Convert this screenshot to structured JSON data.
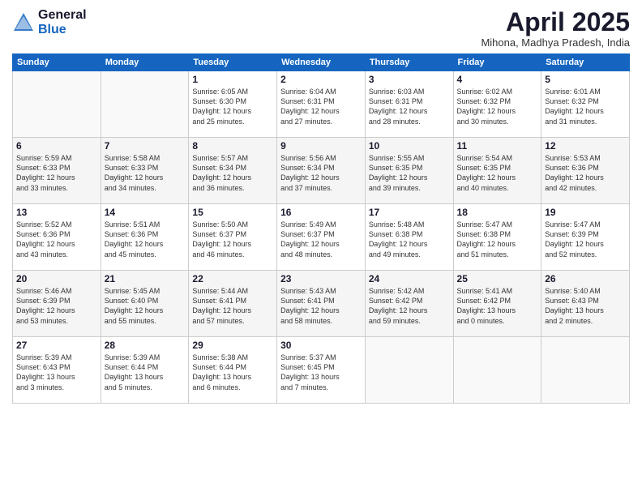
{
  "logo": {
    "general": "General",
    "blue": "Blue"
  },
  "title": "April 2025",
  "location": "Mihona, Madhya Pradesh, India",
  "weekdays": [
    "Sunday",
    "Monday",
    "Tuesday",
    "Wednesday",
    "Thursday",
    "Friday",
    "Saturday"
  ],
  "weeks": [
    [
      {
        "day": "",
        "detail": ""
      },
      {
        "day": "",
        "detail": ""
      },
      {
        "day": "1",
        "detail": "Sunrise: 6:05 AM\nSunset: 6:30 PM\nDaylight: 12 hours\nand 25 minutes."
      },
      {
        "day": "2",
        "detail": "Sunrise: 6:04 AM\nSunset: 6:31 PM\nDaylight: 12 hours\nand 27 minutes."
      },
      {
        "day": "3",
        "detail": "Sunrise: 6:03 AM\nSunset: 6:31 PM\nDaylight: 12 hours\nand 28 minutes."
      },
      {
        "day": "4",
        "detail": "Sunrise: 6:02 AM\nSunset: 6:32 PM\nDaylight: 12 hours\nand 30 minutes."
      },
      {
        "day": "5",
        "detail": "Sunrise: 6:01 AM\nSunset: 6:32 PM\nDaylight: 12 hours\nand 31 minutes."
      }
    ],
    [
      {
        "day": "6",
        "detail": "Sunrise: 5:59 AM\nSunset: 6:33 PM\nDaylight: 12 hours\nand 33 minutes."
      },
      {
        "day": "7",
        "detail": "Sunrise: 5:58 AM\nSunset: 6:33 PM\nDaylight: 12 hours\nand 34 minutes."
      },
      {
        "day": "8",
        "detail": "Sunrise: 5:57 AM\nSunset: 6:34 PM\nDaylight: 12 hours\nand 36 minutes."
      },
      {
        "day": "9",
        "detail": "Sunrise: 5:56 AM\nSunset: 6:34 PM\nDaylight: 12 hours\nand 37 minutes."
      },
      {
        "day": "10",
        "detail": "Sunrise: 5:55 AM\nSunset: 6:35 PM\nDaylight: 12 hours\nand 39 minutes."
      },
      {
        "day": "11",
        "detail": "Sunrise: 5:54 AM\nSunset: 6:35 PM\nDaylight: 12 hours\nand 40 minutes."
      },
      {
        "day": "12",
        "detail": "Sunrise: 5:53 AM\nSunset: 6:36 PM\nDaylight: 12 hours\nand 42 minutes."
      }
    ],
    [
      {
        "day": "13",
        "detail": "Sunrise: 5:52 AM\nSunset: 6:36 PM\nDaylight: 12 hours\nand 43 minutes."
      },
      {
        "day": "14",
        "detail": "Sunrise: 5:51 AM\nSunset: 6:36 PM\nDaylight: 12 hours\nand 45 minutes."
      },
      {
        "day": "15",
        "detail": "Sunrise: 5:50 AM\nSunset: 6:37 PM\nDaylight: 12 hours\nand 46 minutes."
      },
      {
        "day": "16",
        "detail": "Sunrise: 5:49 AM\nSunset: 6:37 PM\nDaylight: 12 hours\nand 48 minutes."
      },
      {
        "day": "17",
        "detail": "Sunrise: 5:48 AM\nSunset: 6:38 PM\nDaylight: 12 hours\nand 49 minutes."
      },
      {
        "day": "18",
        "detail": "Sunrise: 5:47 AM\nSunset: 6:38 PM\nDaylight: 12 hours\nand 51 minutes."
      },
      {
        "day": "19",
        "detail": "Sunrise: 5:47 AM\nSunset: 6:39 PM\nDaylight: 12 hours\nand 52 minutes."
      }
    ],
    [
      {
        "day": "20",
        "detail": "Sunrise: 5:46 AM\nSunset: 6:39 PM\nDaylight: 12 hours\nand 53 minutes."
      },
      {
        "day": "21",
        "detail": "Sunrise: 5:45 AM\nSunset: 6:40 PM\nDaylight: 12 hours\nand 55 minutes."
      },
      {
        "day": "22",
        "detail": "Sunrise: 5:44 AM\nSunset: 6:41 PM\nDaylight: 12 hours\nand 57 minutes."
      },
      {
        "day": "23",
        "detail": "Sunrise: 5:43 AM\nSunset: 6:41 PM\nDaylight: 12 hours\nand 58 minutes."
      },
      {
        "day": "24",
        "detail": "Sunrise: 5:42 AM\nSunset: 6:42 PM\nDaylight: 12 hours\nand 59 minutes."
      },
      {
        "day": "25",
        "detail": "Sunrise: 5:41 AM\nSunset: 6:42 PM\nDaylight: 13 hours\nand 0 minutes."
      },
      {
        "day": "26",
        "detail": "Sunrise: 5:40 AM\nSunset: 6:43 PM\nDaylight: 13 hours\nand 2 minutes."
      }
    ],
    [
      {
        "day": "27",
        "detail": "Sunrise: 5:39 AM\nSunset: 6:43 PM\nDaylight: 13 hours\nand 3 minutes."
      },
      {
        "day": "28",
        "detail": "Sunrise: 5:39 AM\nSunset: 6:44 PM\nDaylight: 13 hours\nand 5 minutes."
      },
      {
        "day": "29",
        "detail": "Sunrise: 5:38 AM\nSunset: 6:44 PM\nDaylight: 13 hours\nand 6 minutes."
      },
      {
        "day": "30",
        "detail": "Sunrise: 5:37 AM\nSunset: 6:45 PM\nDaylight: 13 hours\nand 7 minutes."
      },
      {
        "day": "",
        "detail": ""
      },
      {
        "day": "",
        "detail": ""
      },
      {
        "day": "",
        "detail": ""
      }
    ]
  ]
}
